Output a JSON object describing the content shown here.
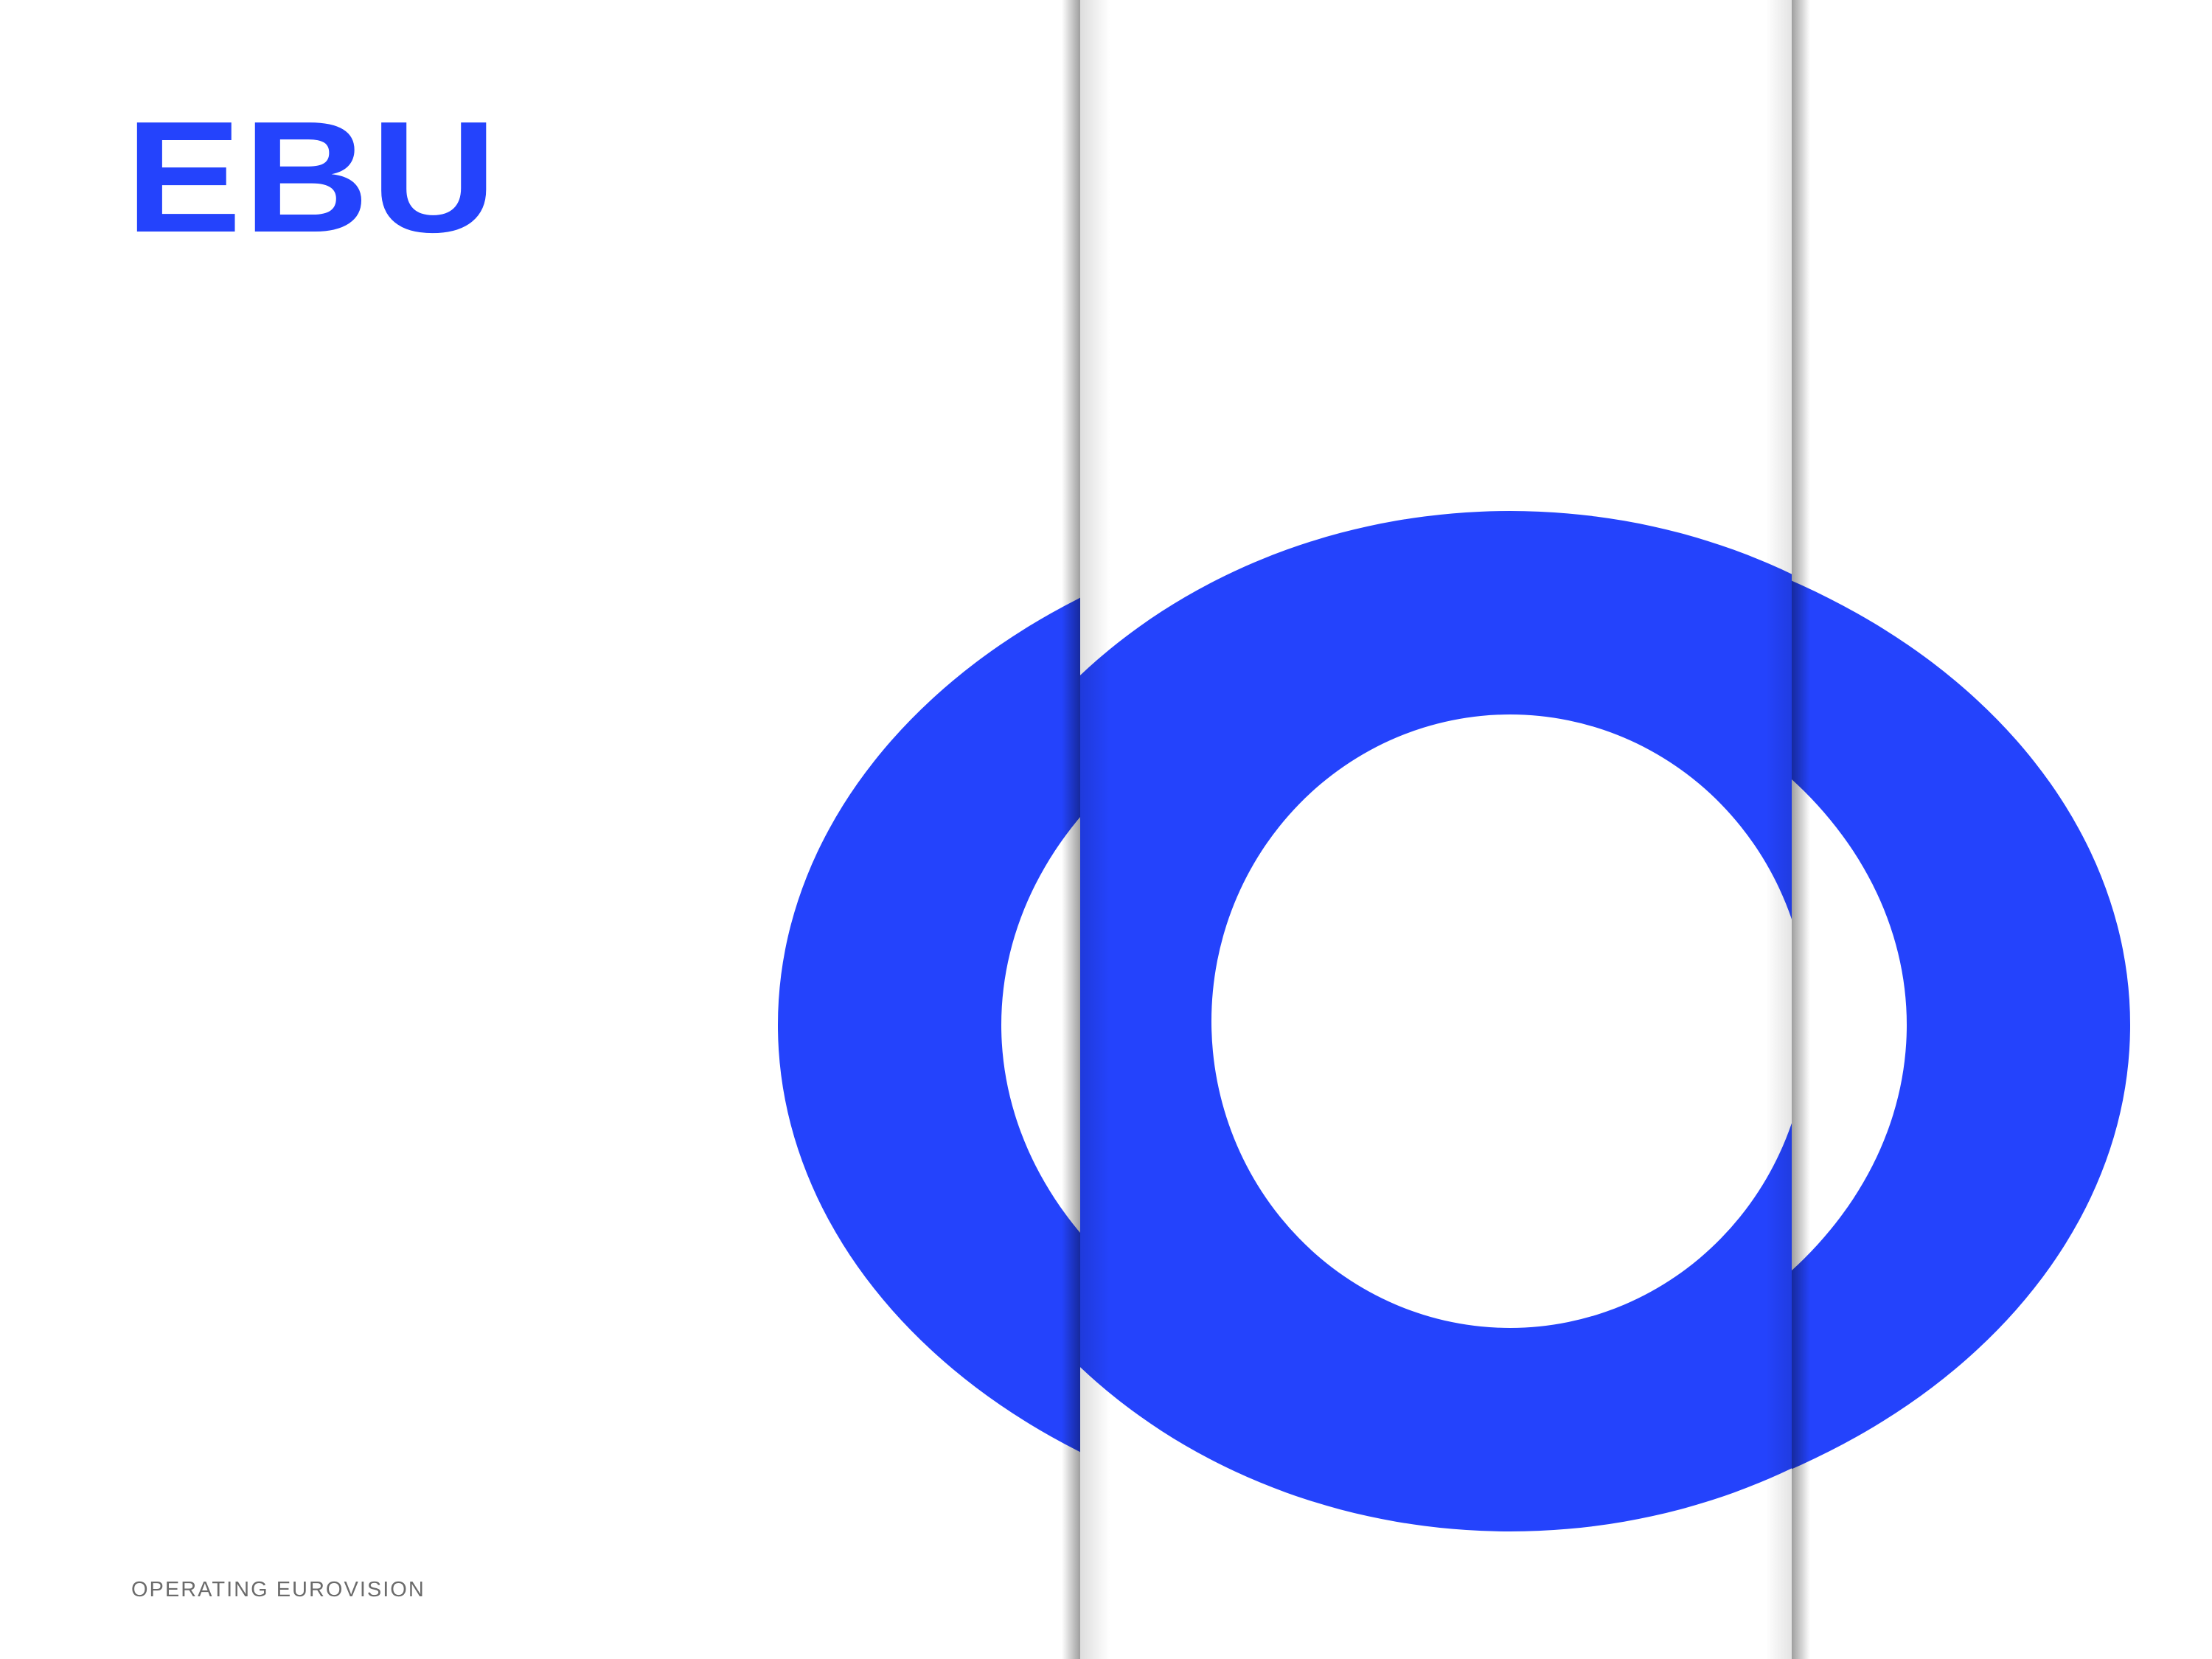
{
  "brand": {
    "logo_text": "EBU",
    "tagline": "OPERATING EUROVISION"
  },
  "colors": {
    "background": "#ffffff",
    "brand_blue": "#2443fc",
    "tagline_gray": "#6b6b6b"
  },
  "graphic": {
    "description_icon": "ring-letter-o-graphic"
  }
}
